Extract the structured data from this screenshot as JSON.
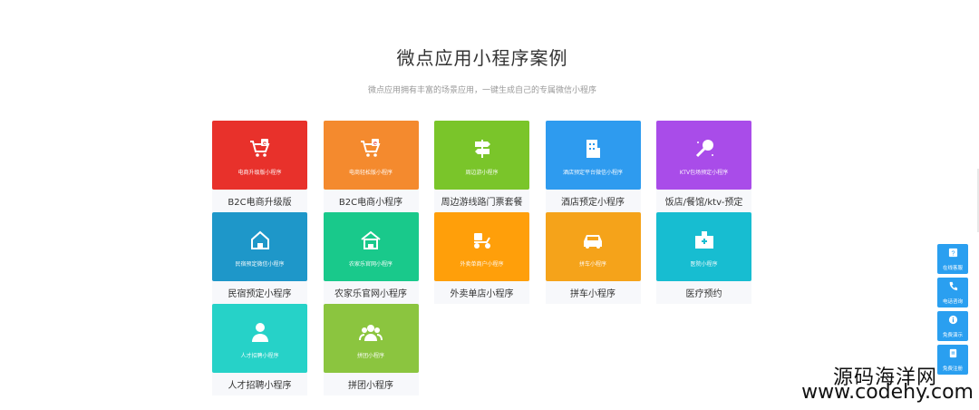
{
  "section": {
    "title": "微点应用小程序案例",
    "subtitle": "微点应用拥有丰富的场景应用，一键生成自己的专属微信小程序"
  },
  "cards": [
    {
      "sub": "电商升级版小程序",
      "name": "B2C电商升级版",
      "color": "#e8312b",
      "icon": "cart-icon"
    },
    {
      "sub": "电商轻松版小程序",
      "name": "B2C电商小程序",
      "color": "#f48a2e",
      "icon": "cart-icon"
    },
    {
      "sub": "周边游小程序",
      "name": "周边游线路门票套餐",
      "color": "#7ac52a",
      "icon": "signpost-icon"
    },
    {
      "sub": "酒店预定平台微信小程序",
      "name": "酒店预定小程序",
      "color": "#2e9bef",
      "icon": "hotel-icon"
    },
    {
      "sub": "KTV包场预定小程序",
      "name": "饭店/餐馆/ktv-预定",
      "color": "#a94ce9",
      "icon": "microphone-icon"
    },
    {
      "sub": "民宿预定微信小程序",
      "name": "民宿预定小程序",
      "color": "#1e97c9",
      "icon": "homestay-icon"
    },
    {
      "sub": "农家乐官网小程序",
      "name": "农家乐官网小程序",
      "color": "#19c98b",
      "icon": "farmhouse-icon"
    },
    {
      "sub": "外卖单商户小程序",
      "name": "外卖单店小程序",
      "color": "#ff9f0a",
      "icon": "scooter-icon"
    },
    {
      "sub": "拼车小程序",
      "name": "拼车小程序",
      "color": "#f5a31a",
      "icon": "car-icon"
    },
    {
      "sub": "医院小程序",
      "name": "医疗预约",
      "color": "#17bdd1",
      "icon": "hospital-icon"
    },
    {
      "sub": "人才招聘小程序",
      "name": "人才招聘小程序",
      "color": "#26d2c8",
      "icon": "person-icon"
    },
    {
      "sub": "拼团小程序",
      "name": "拼团小程序",
      "color": "#8bc53f",
      "icon": "group-icon"
    }
  ],
  "sidebar": {
    "buttons": [
      {
        "label": "在线客服",
        "icon": "question-icon"
      },
      {
        "label": "电话咨询",
        "icon": "phone-icon"
      },
      {
        "label": "免费演示",
        "icon": "info-icon"
      },
      {
        "label": "免费注册",
        "icon": "document-icon"
      }
    ]
  },
  "watermark": {
    "line1": "源码海洋网",
    "line2": "www.codehy.com"
  }
}
